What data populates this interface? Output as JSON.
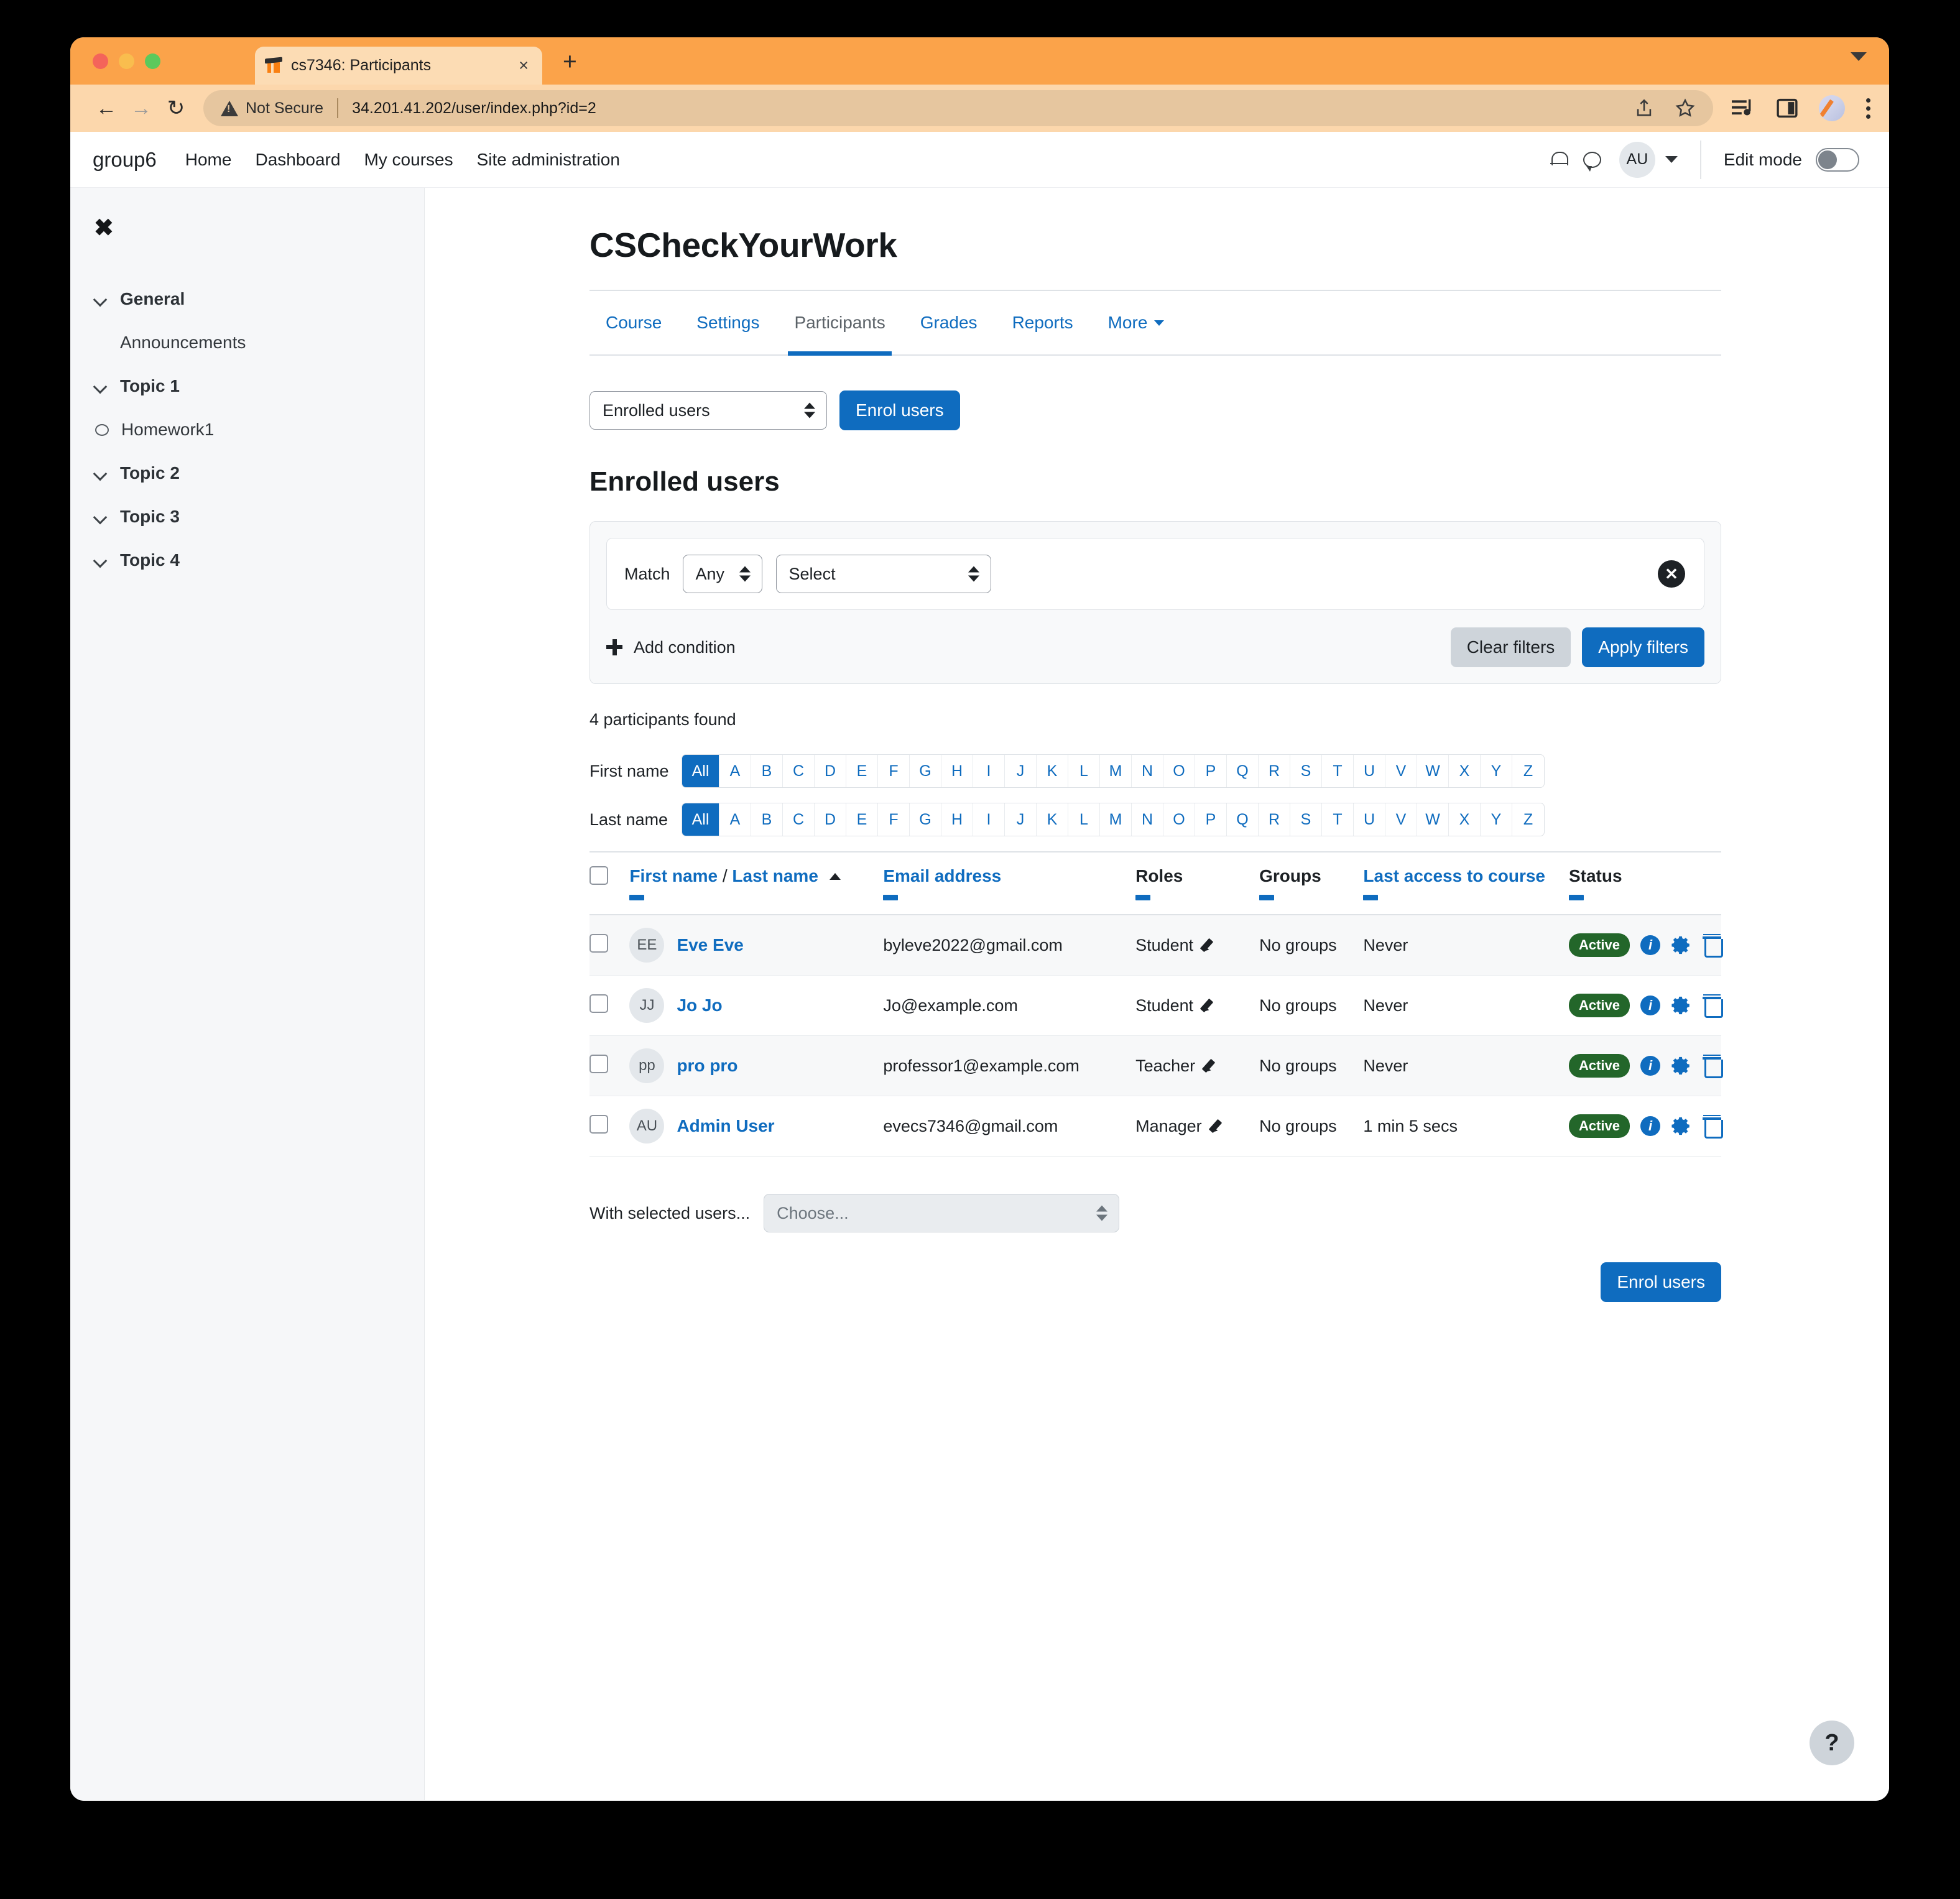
{
  "browser": {
    "tab": {
      "title": "cs7346: Participants",
      "favicon": "moodle-icon",
      "close": "×"
    },
    "new_tab_label": "+",
    "nav": {
      "back": "←",
      "forward": "→",
      "reload": "↻"
    },
    "omnibox": {
      "security_label": "Not Secure",
      "url": "34.201.41.202/user/index.php?id=2"
    },
    "toolbar_icons": [
      "share-icon",
      "bookmark-star-icon",
      "reading-list-icon",
      "side-panel-icon",
      "profile-avatar-icon",
      "browser-menu-icon"
    ]
  },
  "navbar": {
    "brand": "group6",
    "links": [
      "Home",
      "Dashboard",
      "My courses",
      "Site administration"
    ],
    "notifications_icon": "bell-icon",
    "messages_icon": "message-bubble-icon",
    "avatar_initials": "AU",
    "edit_mode_label": "Edit mode",
    "edit_mode_on": false
  },
  "sidebar": {
    "close_label": "✖",
    "items": [
      {
        "label": "General",
        "type": "section",
        "bold": true
      },
      {
        "label": "Announcements",
        "type": "activity",
        "bold": false
      },
      {
        "label": "Topic 1",
        "type": "section",
        "bold": true
      },
      {
        "label": "Homework1",
        "type": "circle",
        "bold": false
      },
      {
        "label": "Topic 2",
        "type": "section",
        "bold": true
      },
      {
        "label": "Topic 3",
        "type": "section",
        "bold": true
      },
      {
        "label": "Topic 4",
        "type": "section",
        "bold": true
      }
    ]
  },
  "main": {
    "course_title": "CSCheckYourWork",
    "tabs": [
      {
        "label": "Course",
        "active": false
      },
      {
        "label": "Settings",
        "active": false
      },
      {
        "label": "Participants",
        "active": true
      },
      {
        "label": "Grades",
        "active": false
      },
      {
        "label": "Reports",
        "active": false
      },
      {
        "label": "More",
        "active": false,
        "caret": true
      }
    ],
    "enrolment_select_value": "Enrolled users",
    "enrol_users_top_label": "Enrol users",
    "section_heading": "Enrolled users",
    "filter": {
      "match_label": "Match",
      "match_value": "Any",
      "select_value": "Select",
      "clear_condition_icon": "clear-circle-icon",
      "add_condition_label": "Add condition",
      "clear_filters_label": "Clear filters",
      "apply_filters_label": "Apply filters"
    },
    "participants_found": "4 participants found",
    "initials": {
      "first_name_label": "First name",
      "last_name_label": "Last name",
      "all_label": "All",
      "letters": [
        "A",
        "B",
        "C",
        "D",
        "E",
        "F",
        "G",
        "H",
        "I",
        "J",
        "K",
        "L",
        "M",
        "N",
        "O",
        "P",
        "Q",
        "R",
        "S",
        "T",
        "U",
        "V",
        "W",
        "X",
        "Y",
        "Z"
      ],
      "first_name_selected": "All",
      "last_name_selected": "All"
    },
    "table": {
      "headers": {
        "first_name": "First name",
        "separator": "/",
        "last_name": "Last name",
        "email": "Email address",
        "roles": "Roles",
        "groups": "Groups",
        "last_access": "Last access to course",
        "status": "Status"
      },
      "sort_column": "Last name",
      "sort_direction": "asc",
      "rows": [
        {
          "initials": "EE",
          "name": "Eve Eve",
          "email": "byleve2022@gmail.com",
          "role": "Student",
          "groups": "No groups",
          "last_access": "Never",
          "status": "Active"
        },
        {
          "initials": "JJ",
          "name": "Jo Jo",
          "email": "Jo@example.com",
          "role": "Student",
          "groups": "No groups",
          "last_access": "Never",
          "status": "Active"
        },
        {
          "initials": "pp",
          "name": "pro pro",
          "email": "professor1@example.com",
          "role": "Teacher",
          "groups": "No groups",
          "last_access": "Never",
          "status": "Active"
        },
        {
          "initials": "AU",
          "name": "Admin User",
          "email": "evecs7346@gmail.com",
          "role": "Manager",
          "groups": "No groups",
          "last_access": "1 min 5 secs",
          "status": "Active"
        }
      ]
    },
    "with_selected_label": "With selected users...",
    "with_selected_value": "Choose...",
    "enrol_users_bottom_label": "Enrol users",
    "help_label": "?"
  },
  "colors": {
    "brand_blue": "#0f6cbf",
    "active_green": "#23662a",
    "chrome_orange": "#fba34a",
    "chrome_tab": "#fcdcb4",
    "sidebar_bg": "#f6f7f9"
  }
}
